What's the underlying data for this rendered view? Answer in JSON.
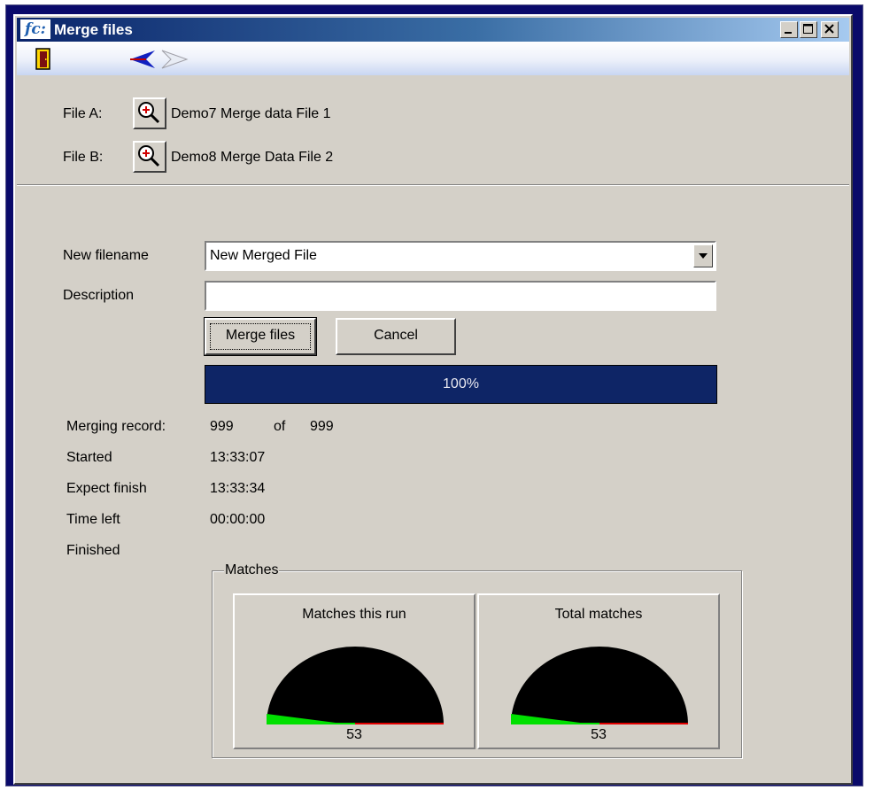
{
  "window": {
    "app_logo": "fc:",
    "title": "Merge files",
    "title_gradient_colors": [
      "#0a246a",
      "#a6caf0"
    ]
  },
  "toolbar": {
    "exit_icon": "door-exit-icon",
    "back_icon": "arrow-back-icon",
    "forward_icon": "arrow-forward-icon"
  },
  "files": {
    "file_a_label": "File A:",
    "file_a_name": "Demo7 Merge data File 1",
    "file_b_label": "File B:",
    "file_b_name": "Demo8 Merge Data File 2",
    "browse_icon": "magnifier-icon"
  },
  "form": {
    "new_filename_label": "New filename",
    "new_filename_value": "New Merged File",
    "description_label": "Description",
    "description_value": ""
  },
  "buttons": {
    "merge": "Merge files",
    "cancel": "Cancel"
  },
  "progress": {
    "percent_text": "100%",
    "value": 1.0,
    "fill_color": "#0e2566"
  },
  "status": {
    "merging_label": "Merging record:",
    "merging_current": "999",
    "of_text": "of",
    "merging_total": "999",
    "started_label": "Started",
    "started_value": "13:33:07",
    "expect_label": "Expect finish",
    "expect_value": "13:33:34",
    "timeleft_label": "Time left",
    "timeleft_value": "00:00:00",
    "finished_label": "Finished"
  },
  "matches": {
    "group_title": "Matches",
    "run": {
      "title": "Matches this run",
      "value": "53"
    },
    "total": {
      "title": "Total matches",
      "value": "53"
    },
    "gauge_colors": {
      "dial": "#000000",
      "needle": "#00e000",
      "low": "#00e000",
      "high": "#e00000"
    }
  }
}
